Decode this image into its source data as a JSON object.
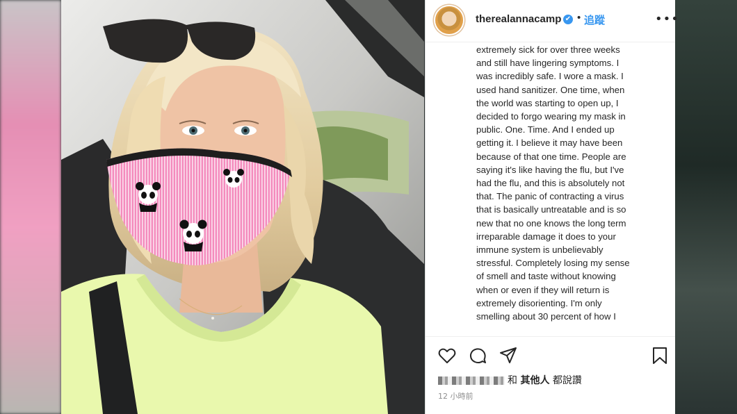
{
  "post": {
    "username": "therealannacamp",
    "verified_badge": "✔",
    "dot_separator": "•",
    "follow_label": "追蹤",
    "more_label": "•••",
    "caption_lines": [
      "extremely sick for over three weeks",
      "and still have lingering symptoms. I",
      "was incredibly safe. I wore a mask. I",
      "used hand sanitizer. One time, when",
      "the world was starting to open up, I",
      "decided to forgo wearing my mask in",
      "public. One. Time. And I ended up",
      "getting it. I believe it may have been",
      "because of that one time. People are",
      "saying it's like having the flu, but I've",
      "had the flu, and this is absolutely not",
      "that. The panic of contracting a virus",
      "that is basically untreatable and is so",
      "new that no one knows the long term",
      "irreparable damage it does to your",
      "immune system is unbelievably",
      "stressful. Completely losing my sense",
      "of smell and taste without knowing",
      "when or even if they will return is",
      "extremely disorienting. I'm only",
      "smelling about 30 percent of how I"
    ],
    "likes_prefix": "和",
    "likes_others": "其他人",
    "likes_suffix": "都說讚",
    "timestamp": "12 小時前"
  },
  "icons": {
    "avatar": "avatar",
    "like": "heart-icon",
    "comment": "comment-icon",
    "share": "share-icon",
    "save": "bookmark-icon"
  },
  "colors": {
    "accent": "#3897f0",
    "text": "#262626",
    "muted": "#8e8e8e",
    "mask_pink": "#f07fb3",
    "top_neon": "#e8f9a8"
  }
}
